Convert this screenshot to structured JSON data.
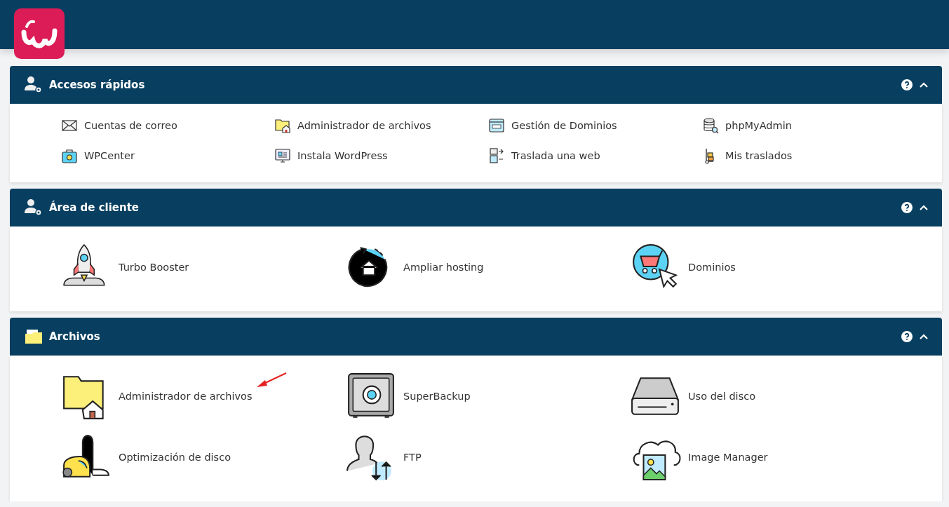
{
  "sections": [
    {
      "title": "Accesos rápidos",
      "kind": "small",
      "expanded": true,
      "items": [
        "Cuentas de correo",
        "Administrador de archivos",
        "Gestión de Dominios",
        "phpMyAdmin",
        "WPCenter",
        "Instala WordPress",
        "Traslada una web",
        "Mis traslados"
      ]
    },
    {
      "title": "Área de cliente",
      "kind": "large",
      "expanded": true,
      "items": [
        "Turbo Booster",
        "Ampliar hosting",
        "Dominios"
      ]
    },
    {
      "title": "Archivos",
      "kind": "large",
      "expanded": true,
      "items": [
        "Administrador de archivos",
        "SuperBackup",
        "Uso del disco",
        "Optimización de disco",
        "FTP",
        "Image Manager"
      ]
    }
  ]
}
